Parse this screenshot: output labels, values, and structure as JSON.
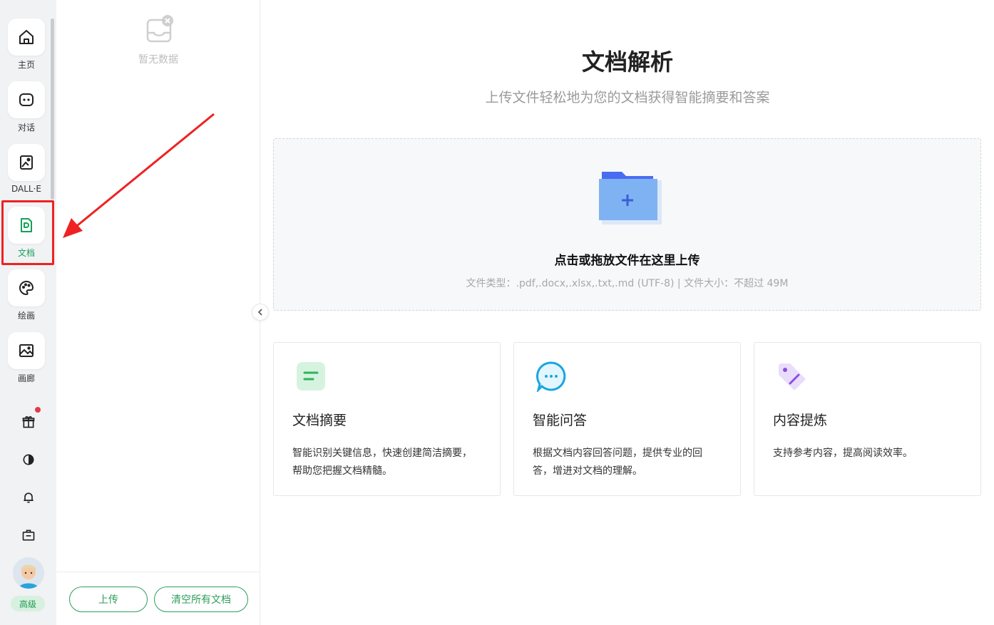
{
  "sidebar": {
    "nav": [
      {
        "label": "主页",
        "icon": "home-icon"
      },
      {
        "label": "对话",
        "icon": "chat-icon"
      },
      {
        "label": "DALL·E",
        "icon": "image-ai-icon"
      },
      {
        "label": "文档",
        "icon": "document-icon",
        "active": true
      },
      {
        "label": "绘画",
        "icon": "palette-icon"
      },
      {
        "label": "画廊",
        "icon": "gallery-icon"
      }
    ],
    "tools": [
      "gift-icon",
      "contrast-icon",
      "bell-icon",
      "briefcase-icon"
    ],
    "tier_badge": "高级"
  },
  "doclist": {
    "empty_text": "暂无数据",
    "upload_label": "上传",
    "clear_label": "清空所有文档"
  },
  "main": {
    "title": "文档解析",
    "subtitle": "上传文件轻松地为您的文档获得智能摘要和答案",
    "dropzone": {
      "title": "点击或拖放文件在这里上传",
      "hint": "文件类型：.pdf,.docx,.xlsx,.txt,.md (UTF-8) |  文件大小：不超过 49M"
    },
    "cards": [
      {
        "title": "文档摘要",
        "desc": "智能识别关键信息，快速创建简洁摘要，帮助您把握文档精髓。",
        "icon": "summary-icon"
      },
      {
        "title": "智能问答",
        "desc": "根据文档内容回答问题，提供专业的回答，增进对文档的理解。",
        "icon": "qa-chat-icon"
      },
      {
        "title": "内容提炼",
        "desc": "支持参考内容，提高阅读效率。",
        "icon": "tag-icon"
      }
    ]
  },
  "colors": {
    "accent_green": "#2e9e5b",
    "highlight_red": "#ee2222",
    "folder_blue": "#4a6cf0"
  }
}
